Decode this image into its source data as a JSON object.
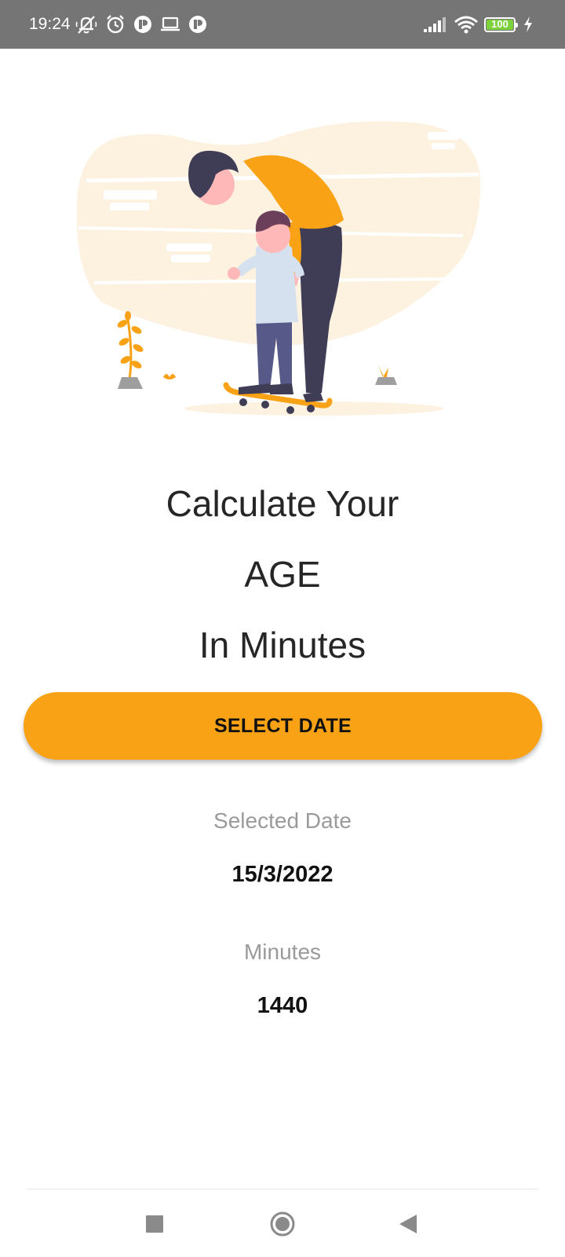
{
  "status_bar": {
    "time": "19:24",
    "battery_level": "100",
    "battery_fraction": 1.0,
    "left_icons": [
      "mute-notifications-icon",
      "alarm-icon",
      "app-icon",
      "laptop-icon",
      "app-icon"
    ],
    "right_icons": [
      "signal-icon",
      "wifi-icon",
      "battery-icon",
      "charging-icon"
    ]
  },
  "illustration": {
    "name": "parent-child-skateboard-illustration",
    "accent": "#f9a216"
  },
  "headline": {
    "line1": "Calculate Your",
    "line2": "AGE",
    "line3": "In Minutes"
  },
  "select_button": {
    "label": "SELECT DATE",
    "color": "#f9a216"
  },
  "selected_date": {
    "label": "Selected Date",
    "value": "15/3/2022"
  },
  "minutes": {
    "label": "Minutes",
    "value": "1440"
  },
  "nav_bar": {
    "buttons": [
      "recents-icon",
      "home-icon",
      "back-icon"
    ]
  }
}
